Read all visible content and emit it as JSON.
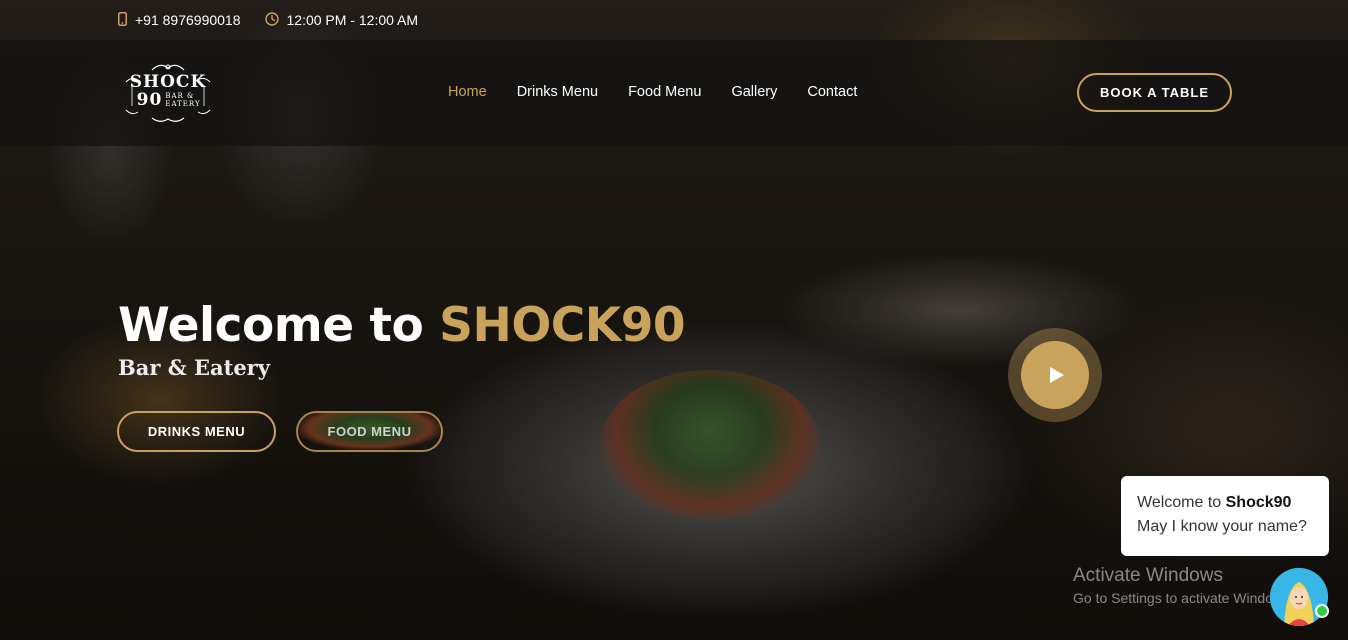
{
  "topbar": {
    "phone": "+91 8976990018",
    "hours": "12:00 PM - 12:00 AM"
  },
  "logo": {
    "main_line1": "SHOCK",
    "main_line2": "90",
    "sub": "BAR & EATERY"
  },
  "nav": {
    "items": [
      {
        "label": "Home",
        "active": true
      },
      {
        "label": "Drinks Menu",
        "active": false
      },
      {
        "label": "Food Menu",
        "active": false
      },
      {
        "label": "Gallery",
        "active": false
      },
      {
        "label": "Contact",
        "active": false
      }
    ],
    "cta": "BOOK A TABLE"
  },
  "hero": {
    "title_prefix": "Welcome to ",
    "title_brand": "SHOCK90",
    "subtitle": "Bar & Eatery",
    "buttons": {
      "drinks": "DRINKS MENU",
      "food": "FOOD MENU"
    }
  },
  "chat": {
    "greeting_prefix": "Welcome to ",
    "greeting_brand": "Shock90",
    "question": "May I know your name?"
  },
  "watermark": {
    "line1": "Activate Windows",
    "line2": "Go to Settings to activate Windows."
  },
  "colors": {
    "accent": "#c9a35c",
    "nav_bg": "#14120f",
    "online": "#2ecc40"
  },
  "icons": {
    "phone": "phone-icon",
    "clock": "clock-icon",
    "play": "play-icon"
  }
}
